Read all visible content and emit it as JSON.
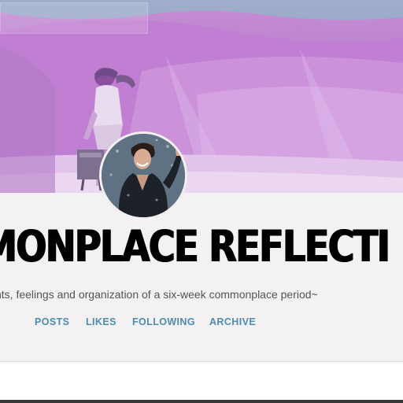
{
  "blog": {
    "title": "MONPLACE REFLECTI",
    "description": "hts, feelings and organization of a six-week commonplace period~"
  },
  "nav": {
    "posts": "POSTS",
    "likes": "LIKES",
    "following": "FOLLOWING",
    "archive": "ARCHIVE"
  },
  "colors": {
    "banner": "#c58fd4",
    "profile_bg": "#f3f1f2",
    "nav_link": "#4d8cb2",
    "title": "#000000"
  },
  "icons": {
    "header_image": "concert-stage-photo",
    "avatar": "profile-photo"
  }
}
